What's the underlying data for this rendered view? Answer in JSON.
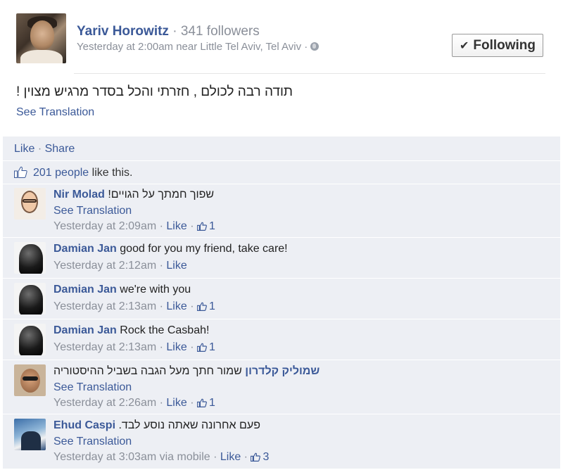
{
  "post": {
    "author": "Yariv Horowitz",
    "followers": "341 followers",
    "timestamp": "Yesterday at 2:00am near Little Tel Aviv, Tel Aviv",
    "follow_button": "Following",
    "text": "תודה רבה לכולם , חזרתי והכל בסדר מרגיש מצוין !",
    "see_translation": "See Translation"
  },
  "feedback": {
    "like_label": "Like",
    "share_label": "Share",
    "likes_count": "201 people",
    "likes_suffix": "like this."
  },
  "comments": [
    {
      "name": "Nir Molad",
      "text": "שפוך חמתך על הגויים!",
      "see_translation": "See Translation",
      "time": "Yesterday at 2:09am",
      "like": "Like",
      "likes": "1"
    },
    {
      "name": "Damian Jan",
      "text": "good for you my friend, take care!",
      "time": "Yesterday at 2:12am",
      "like": "Like"
    },
    {
      "name": "Damian Jan",
      "text": "we're with you",
      "time": "Yesterday at 2:13am",
      "like": "Like",
      "likes": "1"
    },
    {
      "name": "Damian Jan",
      "text": "Rock the Casbah!",
      "time": "Yesterday at 2:13am",
      "like": "Like",
      "likes": "1"
    },
    {
      "name": "שמוליק קלדרון",
      "text": "שמור חתך מעל הגבה בשביל ההיסטוריה",
      "see_translation": "See Translation",
      "time": "Yesterday at 2:26am",
      "like": "Like",
      "likes": "1"
    },
    {
      "name": "Ehud Caspi",
      "text": "פעם אחרונה שאתה נוסע לבד.",
      "see_translation": "See Translation",
      "time": "Yesterday at 3:03am via mobile",
      "like": "Like",
      "likes": "3"
    }
  ],
  "colors": {
    "link": "#3b5998",
    "muted": "#8a8f99",
    "feedback_bg": "#edeff4"
  },
  "icons": [
    "globe-icon",
    "check-icon",
    "thumbs-up-icon"
  ]
}
